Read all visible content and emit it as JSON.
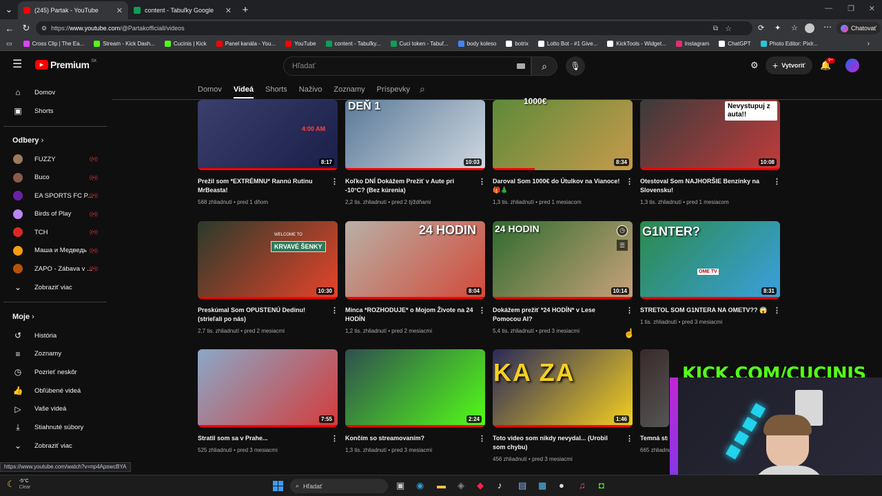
{
  "browser": {
    "tabs": [
      {
        "title": "(245) Partak - YouTube",
        "active": true,
        "color": "#ff0000"
      },
      {
        "title": "content - Tabuľky Google",
        "active": false,
        "color": "#0f9d58"
      }
    ],
    "url_prefix": "https://",
    "url_domain": "www.youtube.com",
    "url_path": "/@Partakofficiall/videos",
    "chatovat": "Chatovať",
    "bookmarks": [
      {
        "label": "Cross Clip | The Ea...",
        "color": "#e040fb"
      },
      {
        "label": "Stream - Kick Dash...",
        "color": "#53fc18"
      },
      {
        "label": "Cucinis | Kick",
        "color": "#53fc18"
      },
      {
        "label": "Panel kanála - You...",
        "color": "#ff0000"
      },
      {
        "label": "YouTube",
        "color": "#ff0000"
      },
      {
        "label": "content - Tabuľky...",
        "color": "#0f9d58"
      },
      {
        "label": "Cuci token - Tabuľ...",
        "color": "#0f9d58"
      },
      {
        "label": "body koleso",
        "color": "#4285f4"
      },
      {
        "label": "botrix",
        "color": "#ffffff"
      },
      {
        "label": "Lotto Bot - #1 Give...",
        "color": "#ffffff"
      },
      {
        "label": "KickTools - Widget...",
        "color": "#ffffff"
      },
      {
        "label": "Instagram",
        "color": "#e1306c"
      },
      {
        "label": "ChatGPT",
        "color": "#ffffff"
      },
      {
        "label": "Photo Editor: Pixlr...",
        "color": "#26c6da"
      }
    ]
  },
  "youtube": {
    "logo": "Premium",
    "logo_region": "SK",
    "search_placeholder": "Hľadať",
    "create_label": "Vytvoriť",
    "notif_count": "9+"
  },
  "sidebar": {
    "main": [
      {
        "label": "Domov",
        "icon": "home-icon"
      },
      {
        "label": "Shorts",
        "icon": "shorts-icon"
      }
    ],
    "subs_header": "Odbery",
    "subs": [
      {
        "label": "FUZZY",
        "color": "#9b7b5b",
        "initials": ""
      },
      {
        "label": "Buco",
        "color": "#8a5a4a",
        "initials": ""
      },
      {
        "label": "EA SPORTS FC P...",
        "color": "#6b21a8",
        "initials": ""
      },
      {
        "label": "Birds of Play",
        "color": "#c084fc",
        "initials": ""
      },
      {
        "label": "TCH",
        "color": "#dc2626",
        "initials": "TCH"
      },
      {
        "label": "Маша и Медведь",
        "color": "#f59e0b",
        "initials": ""
      },
      {
        "label": "ZAPO - Zábava v ...",
        "color": "#b45309",
        "initials": ""
      }
    ],
    "subs_more": "Zobraziť viac",
    "mine_header": "Moje",
    "mine": [
      {
        "label": "História",
        "icon": "history-icon"
      },
      {
        "label": "Zoznamy",
        "icon": "playlists-icon"
      },
      {
        "label": "Pozrieť neskôr",
        "icon": "watch-later-icon"
      },
      {
        "label": "Obľúbené videá",
        "icon": "liked-icon"
      },
      {
        "label": "Vaše videá",
        "icon": "your-videos-icon"
      },
      {
        "label": "Stiahnuté súbory",
        "icon": "downloads-icon"
      }
    ],
    "mine_more": "Zobraziť viac"
  },
  "channel_tabs": [
    "Domov",
    "Videá",
    "Shorts",
    "Naživo",
    "Zoznamy",
    "Príspevky"
  ],
  "videos": [
    {
      "title": "Prežil som *EXTRÉMNU* Rannú Rutinu MrBeasta!",
      "meta": "568 zhliadnutí • pred 1 dňom",
      "duration": "8:17",
      "bg": "#3a3f6b",
      "accent": "#1a1f4a",
      "progress": 1.0
    },
    {
      "title": "Koľko DNÍ Dokážem Prežiť v Aute pri -10°C? (Bez kúrenia)",
      "meta": "2,2 tis. zhliadnutí • pred 2 týždňami",
      "duration": "10:03",
      "bg": "#5b7a99",
      "accent": "#cfd8e0",
      "progress": 1.0
    },
    {
      "title": "Daroval Som 1000€ do Útulkov na Vianoce! 🎁🎄",
      "meta": "1,3 tis. zhliadnutí • pred 1 mesiacom",
      "duration": "8:34",
      "bg": "#5d8a3a",
      "accent": "#c79a4b",
      "progress": 0.3
    },
    {
      "title": "Otestoval Som NAJHORŠIE Benzínky na Slovensku!",
      "meta": "1,3 tis. zhliadnutí • pred 1 mesiacom",
      "duration": "10:08",
      "bg": "#3b3b3b",
      "accent": "#c23b3b",
      "progress": 1.0
    },
    {
      "title": "Preskúmal Som OPUSTENÚ Dedinu! (strieľali po nás)",
      "meta": "2,7 tis. zhliadnutí • pred 2 mesiacmi",
      "duration": "10:30",
      "bg": "#2b3a2b",
      "accent": "#e8442a",
      "progress": 1.0
    },
    {
      "title": "Minca *ROZHODUJE* o Mojom Živote na 24 HODÍN",
      "meta": "1,2 tis. zhliadnutí • pred 2 mesiacmi",
      "duration": "8:04",
      "bg": "#b8b0a6",
      "accent": "#d24a3a",
      "progress": 1.0
    },
    {
      "title": "Dokážem prežiť *24 HODÍN* v Lese Pomocou AI?",
      "meta": "5,4 tis. zhliadnutí • pred 3 mesiacmi",
      "duration": "10:14",
      "bg": "#2f6b2f",
      "accent": "#c9a27a",
      "progress": 1.0
    },
    {
      "title": "STRETOL SOM G1NTERA NA OMETV?? 😱",
      "meta": "1 tis. zhliadnutí • pred 3 mesiacmi",
      "duration": "8:31",
      "bg": "#2b8a4a",
      "accent": "#3aa0e0",
      "progress": 1.0
    },
    {
      "title": "Stratil som sa v Prahe...",
      "meta": "525 zhliadnutí • pred 3 mesiacmi",
      "duration": "7:55",
      "bg": "#8aa8c8",
      "accent": "#d43b3b",
      "progress": 1.0
    },
    {
      "title": "Končím so streamovaním?",
      "meta": "1,3 tis. zhliadnutí • pred 3 mesiacmi",
      "duration": "2:24",
      "bg": "#2f4f4f",
      "accent": "#53fc18",
      "progress": 1.0
    },
    {
      "title": "Toto video som nikdy nevydal... (Urobil som chybu)",
      "meta": "456 zhliadnutí • pred 3 mesiacmi",
      "duration": "1:46",
      "bg": "#2a2a5a",
      "accent": "#f5d020",
      "progress": 1.0
    },
    {
      "title": "Temná str",
      "meta": "665 zhliadnutí",
      "duration": "",
      "bg": "#3a2a2a",
      "accent": "#555555",
      "progress": 0
    }
  ],
  "thumb_text": {
    "t1": "4:00 AM",
    "t2": "DEŇ 1",
    "t3": "1000€",
    "t4": "Nevystupuj z auta!!",
    "t5": "WELCOME TO",
    "t5b": "KRVAVÉ ŠENKY",
    "t6": "24 HODIN",
    "t7": "24 HODIN",
    "t8": "G1NTER?",
    "t8b": "OME TV",
    "t11": "KA ZA"
  },
  "status_url": "https://www.youtube.com/watch?v=np4ApswcBYA",
  "taskbar": {
    "weather_temp": "-5°C",
    "weather_desc": "Clear",
    "search": "Hľadať"
  },
  "overlay": {
    "kick_text": "KICK.COM/CUCINIS"
  }
}
